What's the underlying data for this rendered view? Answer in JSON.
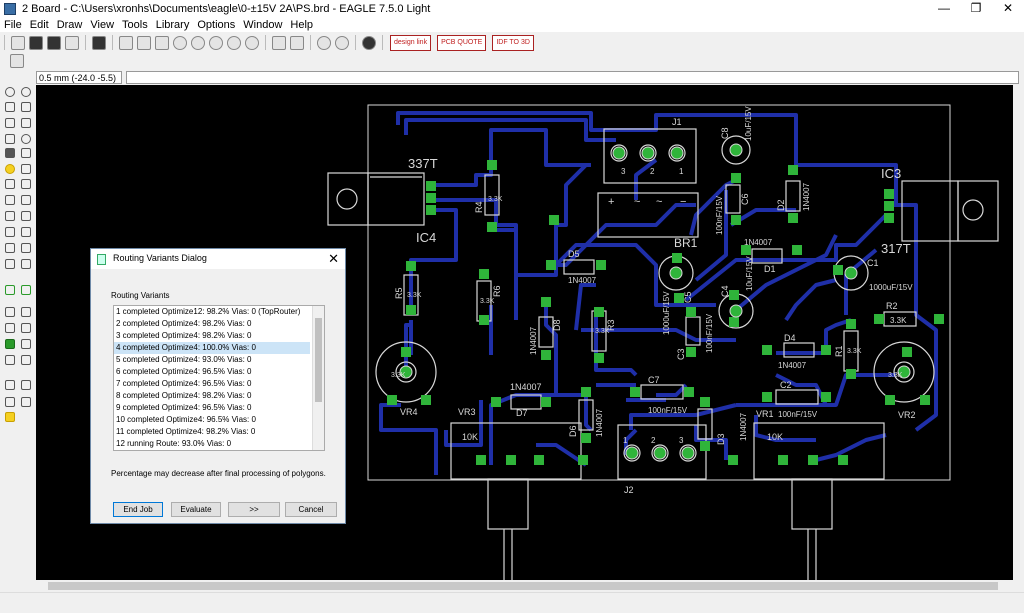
{
  "window": {
    "title": "2 Board - C:\\Users\\xronhs\\Documents\\eagle\\0-±15V 2A\\PS.brd - EAGLE 7.5.0 Light",
    "minimize": "—",
    "maximize": "❐",
    "close": "✕"
  },
  "menu": {
    "items": [
      "File",
      "Edit",
      "Draw",
      "View",
      "Tools",
      "Library",
      "Options",
      "Window",
      "Help"
    ]
  },
  "toolbar": {
    "design_link_label": "design link",
    "pcb_quote_label": "PCB QUOTE",
    "idf_label": "IDF TO 3D"
  },
  "command_line": {
    "coordinate": "0.5 mm (-24.0 -5.5)",
    "value": ""
  },
  "board": {
    "labels": {
      "ic4_label": "IC4",
      "ic4_part": "337T",
      "ic3_label": "IC3",
      "ic3_part": "317T",
      "j1": "J1",
      "j2": "J2",
      "br1": "BR1",
      "c1": "C1",
      "c1_val": "1000uF/15V",
      "c3": "C3",
      "c3_val": "100nF/15V",
      "c4": "C4",
      "c4_val": "10uF/15V",
      "c5": "C5",
      "c5_val": "1000uF/15V",
      "c6": "C6",
      "c6_val": "100nF/15V",
      "c7": "C7",
      "c7_val": "100nF/15V",
      "c2": "C2",
      "c2_val": "100nF/15V",
      "c8": "C8",
      "c8_val": "10uF/15V",
      "c_top_val": "10uF/15V",
      "d1": "D1",
      "d1_val": "1N4007",
      "d2": "D2",
      "d2_val": "1N4007",
      "d3": "D3",
      "d3_val": "1N4007",
      "d4": "D4",
      "d4_val": "1N4007",
      "d5": "D5",
      "d5_val": "1N4007",
      "d6": "D6",
      "d6_val": "1N4007",
      "d7": "D7",
      "d7_val": "1N4007",
      "d8": "D8",
      "d8_val": "1N4007",
      "r1": "R1",
      "r2": "R2",
      "r2_val": "3.3K",
      "r3": "R3",
      "r4": "R4",
      "r4_val": "3.3K",
      "r5": "R5",
      "r6": "R6",
      "r_val": "3.3K",
      "vr1": "VR1",
      "vr2": "VR2",
      "vr3": "VR3",
      "vr4": "VR4",
      "vr_val": "10K",
      "pot_val": "3.3K",
      "pin1": "1",
      "pin2": "2",
      "pin3": "3",
      "plus": "+",
      "minus": "−",
      "ac": "~"
    }
  },
  "dialog": {
    "title": "Routing Variants Dialog",
    "group_label": "Routing Variants",
    "variants": [
      "1 completed Optimize12:  98.2%  Vias: 0 (TopRouter)",
      "2 completed Optimize4:  98.2%  Vias: 0",
      "3 completed Optimize4:  98.2%  Vias: 0",
      "4 completed Optimize4:  100.0%  Vias: 0",
      "5 completed Optimize4:  93.0%  Vias: 0",
      "6 completed Optimize4:  96.5%  Vias: 0",
      "7 completed Optimize4:  96.5%  Vias: 0",
      "8 completed Optimize4:  98.2%  Vias: 0",
      "9 completed Optimize4:  96.5%  Vias: 0",
      "10 completed Optimize4:  96.5%  Vias: 0",
      "11 completed Optimize4:  98.2%  Vias: 0",
      "12 running Route:  93.0%  Vias: 0"
    ],
    "note": "Percentage may decrease after final processing of polygons.",
    "buttons": {
      "end_job": "End Job",
      "evaluate": "Evaluate",
      "more": ">>",
      "cancel": "Cancel"
    },
    "close": "✕"
  },
  "colors": {
    "trace": "#1f2fa8",
    "pad": "#2fb43a",
    "silk": "#d8d8d8",
    "background": "#000000",
    "selected_row": "#cce4f7"
  }
}
